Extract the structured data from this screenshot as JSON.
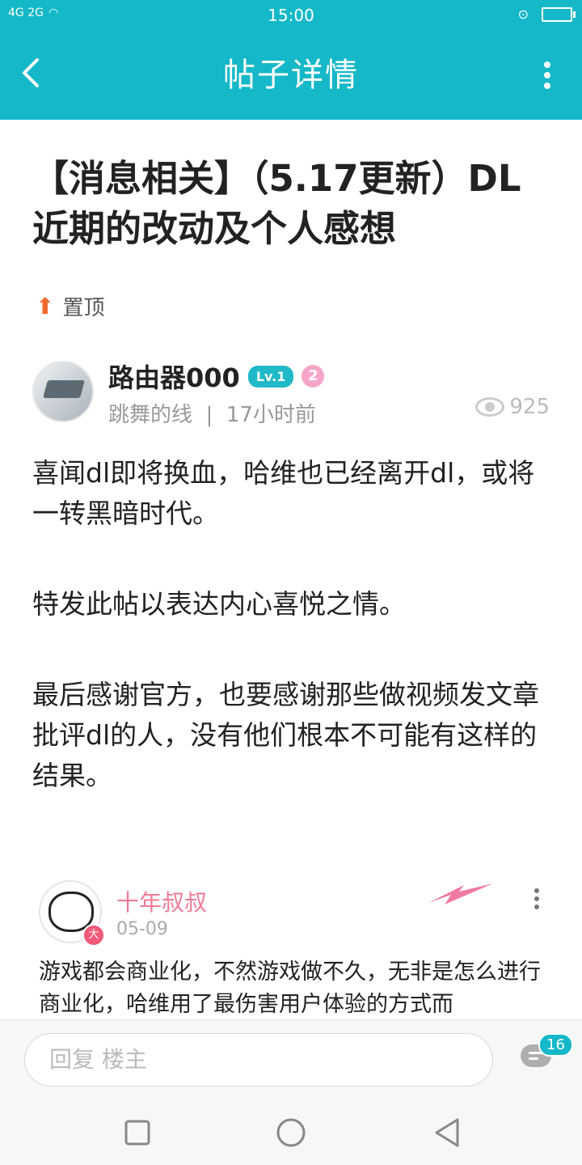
{
  "status_bar": {
    "signal": "4G 2G",
    "time": "15:00"
  },
  "app_bar": {
    "title": "帖子详情"
  },
  "post": {
    "title": "【消息相关】（5.17更新）DL近期的改动及个人感想",
    "pin_label": "置顶",
    "author": {
      "name": "路由器000",
      "level": "Lv.1",
      "badge": "2"
    },
    "board": "跳舞的线",
    "time_ago": "17小时前",
    "views": "925",
    "paragraphs": [
      "喜闻dl即将换血，哈维也已经离开dl，或将一转黑暗时代。",
      "特发此帖以表达内心喜悦之情。",
      "最后感谢官方，也要感谢那些做视频发文章批评dl的人，没有他们根本不可能有这样的结果。"
    ]
  },
  "comment": {
    "author": "十年叔叔",
    "avatar_tag": "大",
    "date": "05-09",
    "text": "游戏都会商业化，不然游戏做不久，无非是怎么进行商业化，哈维用了最伤害用户体验的方式而"
  },
  "reply_bar": {
    "placeholder": "回复  楼主",
    "comment_count": "16"
  },
  "colors": {
    "primary": "#14b8c8",
    "pin_arrow": "#f06a30",
    "comment_name": "#f07a96"
  }
}
